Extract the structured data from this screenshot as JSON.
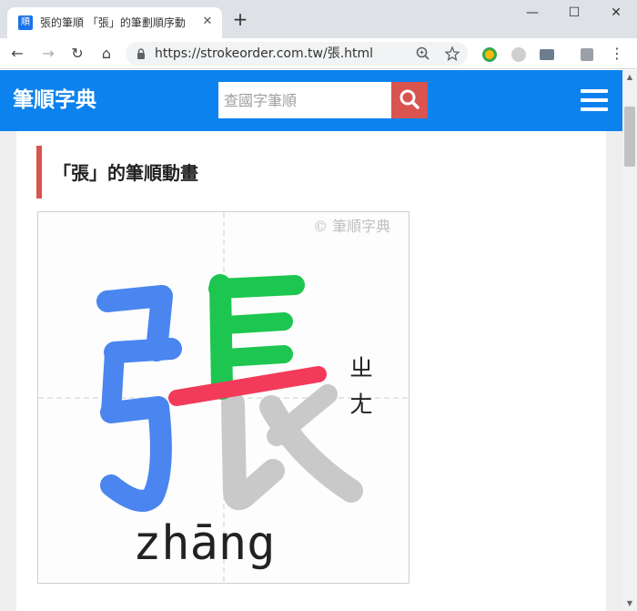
{
  "browser": {
    "tab": {
      "favicon_char": "順",
      "title": "張的筆順 「張」的筆劃順序動畫",
      "close_glyph": "✕"
    },
    "new_tab_glyph": "+",
    "window": {
      "minimize": "—",
      "maximize": "☐",
      "close": "✕"
    },
    "toolbar": {
      "back": "←",
      "forward": "→",
      "reload": "↻",
      "home": "⌂",
      "url": "https://strokeorder.com.tw/張.html",
      "menu": "⋮"
    }
  },
  "site": {
    "brand": "筆順字典",
    "search": {
      "placeholder": "查國字筆順"
    },
    "colors": {
      "header": "#0b82ee",
      "accent": "#d9534f"
    }
  },
  "section": {
    "heading": "「張」的筆順動畫"
  },
  "animation": {
    "character": "張",
    "watermark": "© 筆順字典",
    "zhuyin": [
      "ㄓ",
      "ㄤ"
    ],
    "pinyin": "zhāng",
    "stroke_colors": {
      "bow_radical": "#4a85f0",
      "top_strokes": "#1dc650",
      "current_stroke": "#f23b5a",
      "pending_strokes": "#c8c9c8"
    }
  },
  "icons": {
    "lock": "lock-icon",
    "zoom": "zoom-icon",
    "star": "star-icon",
    "search": "search-icon",
    "menu": "hamburger-menu-icon"
  }
}
